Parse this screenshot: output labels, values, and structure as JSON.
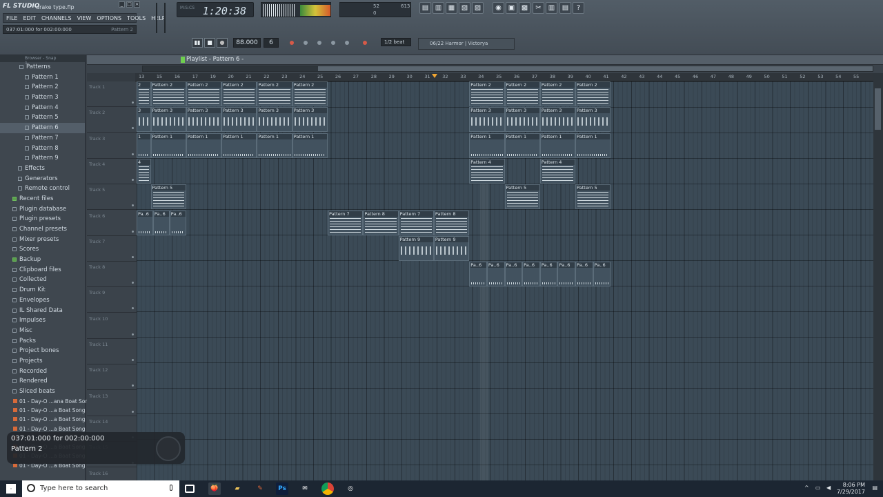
{
  "app": {
    "logo": "FL STUDIO",
    "file_name": "drake type.flp"
  },
  "menu": [
    "FILE",
    "EDIT",
    "CHANNELS",
    "VIEW",
    "OPTIONS",
    "TOOLS",
    "HELP"
  ],
  "hint": {
    "text": "037:01:000 for 002:00:000",
    "right": "Pattern 2"
  },
  "time": {
    "value": "1:20:38",
    "units": "M:S:CS"
  },
  "cpu": {
    "cpu": "52",
    "mem": "613",
    "voices": "0"
  },
  "transport": {
    "tempo": "88.000",
    "pattern": "6",
    "snap": "1/2 beat",
    "hint_bar": "06/22  Harmor | Victorya"
  },
  "playlist": {
    "title": "Playlist - Pattern 6 -"
  },
  "browser": {
    "header": "Browser - Snap 1",
    "items": [
      {
        "label": "Patterns",
        "type": "root"
      },
      {
        "label": "Pattern 1",
        "type": "pattern"
      },
      {
        "label": "Pattern 2",
        "type": "pattern"
      },
      {
        "label": "Pattern 3",
        "type": "pattern"
      },
      {
        "label": "Pattern 4",
        "type": "pattern"
      },
      {
        "label": "Pattern 5",
        "type": "pattern"
      },
      {
        "label": "Pattern 6",
        "type": "pattern",
        "selected": true
      },
      {
        "label": "Pattern 7",
        "type": "pattern"
      },
      {
        "label": "Pattern 8",
        "type": "pattern"
      },
      {
        "label": "Pattern 9",
        "type": "pattern"
      },
      {
        "label": "Effects",
        "type": "sub"
      },
      {
        "label": "Generators",
        "type": "sub"
      },
      {
        "label": "Remote control",
        "type": "sub"
      },
      {
        "label": "Recent files",
        "type": "green"
      },
      {
        "label": "Plugin database",
        "type": "folder"
      },
      {
        "label": "Plugin presets",
        "type": "folder"
      },
      {
        "label": "Channel presets",
        "type": "folder"
      },
      {
        "label": "Mixer presets",
        "type": "folder"
      },
      {
        "label": "Scores",
        "type": "folder"
      },
      {
        "label": "Backup",
        "type": "green"
      },
      {
        "label": "Clipboard files",
        "type": "folder"
      },
      {
        "label": "Collected",
        "type": "folder"
      },
      {
        "label": "Drum Kit",
        "type": "folder"
      },
      {
        "label": "Envelopes",
        "type": "folder"
      },
      {
        "label": "IL Shared Data",
        "type": "folder"
      },
      {
        "label": "Impulses",
        "type": "folder"
      },
      {
        "label": "Misc",
        "type": "folder"
      },
      {
        "label": "Packs",
        "type": "folder"
      },
      {
        "label": "Project bones",
        "type": "folder"
      },
      {
        "label": "Projects",
        "type": "folder"
      },
      {
        "label": "Recorded",
        "type": "folder"
      },
      {
        "label": "Rendered",
        "type": "folder"
      },
      {
        "label": "Sliced beats",
        "type": "folder"
      }
    ],
    "files": [
      "01 - Day-O ...ana Boat Song",
      "01 - Day-O ...a Boat Song 2",
      "01 - Day-O ...a Boat Song 3",
      "01 - Day-O ...a Boat Song 4",
      "01 - Day-O ...a Boat Song 5",
      "01 - Day-O ...a Boat Song 6",
      "01 - Day-O ...a Boat Song 7",
      "01 - Day-O ...a Boat Song 8"
    ]
  },
  "ruler": [
    "13",
    "15",
    "16",
    "17",
    "19",
    "20",
    "21",
    "22",
    "23",
    "24",
    "25",
    "26",
    "27",
    "28",
    "29",
    "30",
    "31",
    "32",
    "33",
    "34",
    "35",
    "36",
    "37",
    "38",
    "39",
    "40",
    "41",
    "42",
    "43",
    "44",
    "45",
    "46",
    "47",
    "48",
    "49",
    "50",
    "51",
    "52",
    "53",
    "54",
    "55"
  ],
  "tracks": [
    "Track 1",
    "Track 2",
    "Track 3",
    "Track 4",
    "Track 5",
    "Track 6",
    "Track 7",
    "Track 8",
    "Track 9",
    "Track 10",
    "Track 11",
    "Track 12",
    "Track 13",
    "Track 14",
    "Track 15",
    "Track 16"
  ],
  "clips": [
    {
      "track": 0,
      "start": 0,
      "len": 0.8,
      "label": "2",
      "kind": "notes"
    },
    {
      "track": 0,
      "start": 0.8,
      "len": 2,
      "label": "Pattern 2",
      "kind": "notes"
    },
    {
      "track": 0,
      "start": 2.8,
      "len": 2,
      "label": "Pattern 2",
      "kind": "notes"
    },
    {
      "track": 0,
      "start": 4.8,
      "len": 2,
      "label": "Pattern 2",
      "kind": "notes"
    },
    {
      "track": 0,
      "start": 6.8,
      "len": 2,
      "label": "Pattern 2",
      "kind": "notes"
    },
    {
      "track": 0,
      "start": 8.8,
      "len": 2,
      "label": "Pattern 2",
      "kind": "notes"
    },
    {
      "track": 0,
      "start": 18.8,
      "len": 2,
      "label": "Pattern 2",
      "kind": "notes"
    },
    {
      "track": 0,
      "start": 20.8,
      "len": 2,
      "label": "Pattern 2",
      "kind": "notes"
    },
    {
      "track": 0,
      "start": 22.8,
      "len": 2,
      "label": "Pattern 2",
      "kind": "notes"
    },
    {
      "track": 0,
      "start": 24.8,
      "len": 2,
      "label": "Pattern 2",
      "kind": "notes"
    },
    {
      "track": 1,
      "start": 0,
      "len": 0.8,
      "label": "3",
      "kind": "dots"
    },
    {
      "track": 1,
      "start": 0.8,
      "len": 2,
      "label": "Pattern 3",
      "kind": "dots"
    },
    {
      "track": 1,
      "start": 2.8,
      "len": 2,
      "label": "Pattern 3",
      "kind": "dots"
    },
    {
      "track": 1,
      "start": 4.8,
      "len": 2,
      "label": "Pattern 3",
      "kind": "dots"
    },
    {
      "track": 1,
      "start": 6.8,
      "len": 2,
      "label": "Pattern 3",
      "kind": "dots"
    },
    {
      "track": 1,
      "start": 8.8,
      "len": 2,
      "label": "Pattern 3",
      "kind": "dots"
    },
    {
      "track": 1,
      "start": 18.8,
      "len": 2,
      "label": "Pattern 3",
      "kind": "dots"
    },
    {
      "track": 1,
      "start": 20.8,
      "len": 2,
      "label": "Pattern 3",
      "kind": "dots"
    },
    {
      "track": 1,
      "start": 22.8,
      "len": 2,
      "label": "Pattern 3",
      "kind": "dots"
    },
    {
      "track": 1,
      "start": 24.8,
      "len": 2,
      "label": "Pattern 3",
      "kind": "dots"
    },
    {
      "track": 2,
      "start": 0,
      "len": 0.8,
      "label": "1",
      "kind": "ticks"
    },
    {
      "track": 2,
      "start": 0.8,
      "len": 2,
      "label": "Pattern 1",
      "kind": "ticks"
    },
    {
      "track": 2,
      "start": 2.8,
      "len": 2,
      "label": "Pattern 1",
      "kind": "ticks"
    },
    {
      "track": 2,
      "start": 4.8,
      "len": 2,
      "label": "Pattern 1",
      "kind": "ticks"
    },
    {
      "track": 2,
      "start": 6.8,
      "len": 2,
      "label": "Pattern 1",
      "kind": "ticks"
    },
    {
      "track": 2,
      "start": 8.8,
      "len": 2,
      "label": "Pattern 1",
      "kind": "ticks"
    },
    {
      "track": 2,
      "start": 18.8,
      "len": 2,
      "label": "Pattern 1",
      "kind": "ticks"
    },
    {
      "track": 2,
      "start": 20.8,
      "len": 2,
      "label": "Pattern 1",
      "kind": "ticks"
    },
    {
      "track": 2,
      "start": 22.8,
      "len": 2,
      "label": "Pattern 1",
      "kind": "ticks"
    },
    {
      "track": 2,
      "start": 24.8,
      "len": 2,
      "label": "Pattern 1",
      "kind": "ticks"
    },
    {
      "track": 3,
      "start": 0,
      "len": 0.8,
      "label": "4",
      "kind": "notes"
    },
    {
      "track": 3,
      "start": 18.8,
      "len": 2,
      "label": "Pattern 4",
      "kind": "notes"
    },
    {
      "track": 3,
      "start": 22.8,
      "len": 2,
      "label": "Pattern 4",
      "kind": "notes"
    },
    {
      "track": 4,
      "start": 0.8,
      "len": 2,
      "label": "Pattern 5",
      "kind": "notes"
    },
    {
      "track": 4,
      "start": 20.8,
      "len": 2,
      "label": "Pattern 5",
      "kind": "notes"
    },
    {
      "track": 4,
      "start": 24.8,
      "len": 2,
      "label": "Pattern 5",
      "kind": "notes"
    },
    {
      "track": 5,
      "start": 0,
      "len": 0.93,
      "label": "Pa..6",
      "kind": "ticks"
    },
    {
      "track": 5,
      "start": 0.93,
      "len": 0.93,
      "label": "Pa..6",
      "kind": "ticks"
    },
    {
      "track": 5,
      "start": 1.86,
      "len": 0.94,
      "label": "Pa..6",
      "kind": "ticks"
    },
    {
      "track": 5,
      "start": 10.8,
      "len": 2,
      "label": "Pattern 7",
      "kind": "notes"
    },
    {
      "track": 5,
      "start": 12.8,
      "len": 2,
      "label": "Pattern 8",
      "kind": "notes"
    },
    {
      "track": 5,
      "start": 14.8,
      "len": 2,
      "label": "Pattern 7",
      "kind": "notes"
    },
    {
      "track": 5,
      "start": 16.8,
      "len": 2,
      "label": "Pattern 8",
      "kind": "notes"
    },
    {
      "track": 6,
      "start": 14.8,
      "len": 2,
      "label": "Pattern 9",
      "kind": "dots"
    },
    {
      "track": 6,
      "start": 16.8,
      "len": 2,
      "label": "Pattern 9",
      "kind": "dots"
    },
    {
      "track": 7,
      "start": 18.8,
      "len": 1,
      "label": "Pa..6",
      "kind": "ticks"
    },
    {
      "track": 7,
      "start": 19.8,
      "len": 1,
      "label": "Pa..6",
      "kind": "ticks"
    },
    {
      "track": 7,
      "start": 20.8,
      "len": 1,
      "label": "Pa..6",
      "kind": "ticks"
    },
    {
      "track": 7,
      "start": 21.8,
      "len": 1,
      "label": "Pa..6",
      "kind": "ticks"
    },
    {
      "track": 7,
      "start": 22.8,
      "len": 1,
      "label": "Pa..6",
      "kind": "ticks"
    },
    {
      "track": 7,
      "start": 23.8,
      "len": 1,
      "label": "Pa..6",
      "kind": "ticks"
    },
    {
      "track": 7,
      "start": 24.8,
      "len": 1,
      "label": "Pa..6",
      "kind": "ticks"
    },
    {
      "track": 7,
      "start": 25.8,
      "len": 1,
      "label": "Pa..6",
      "kind": "ticks"
    }
  ],
  "popup": {
    "line1": "037:01:000 for 002:00:000",
    "line2": "Pattern 2"
  },
  "taskbar": {
    "search_placeholder": "Type here to search",
    "time": "8:06 PM",
    "date": "7/29/2017"
  }
}
